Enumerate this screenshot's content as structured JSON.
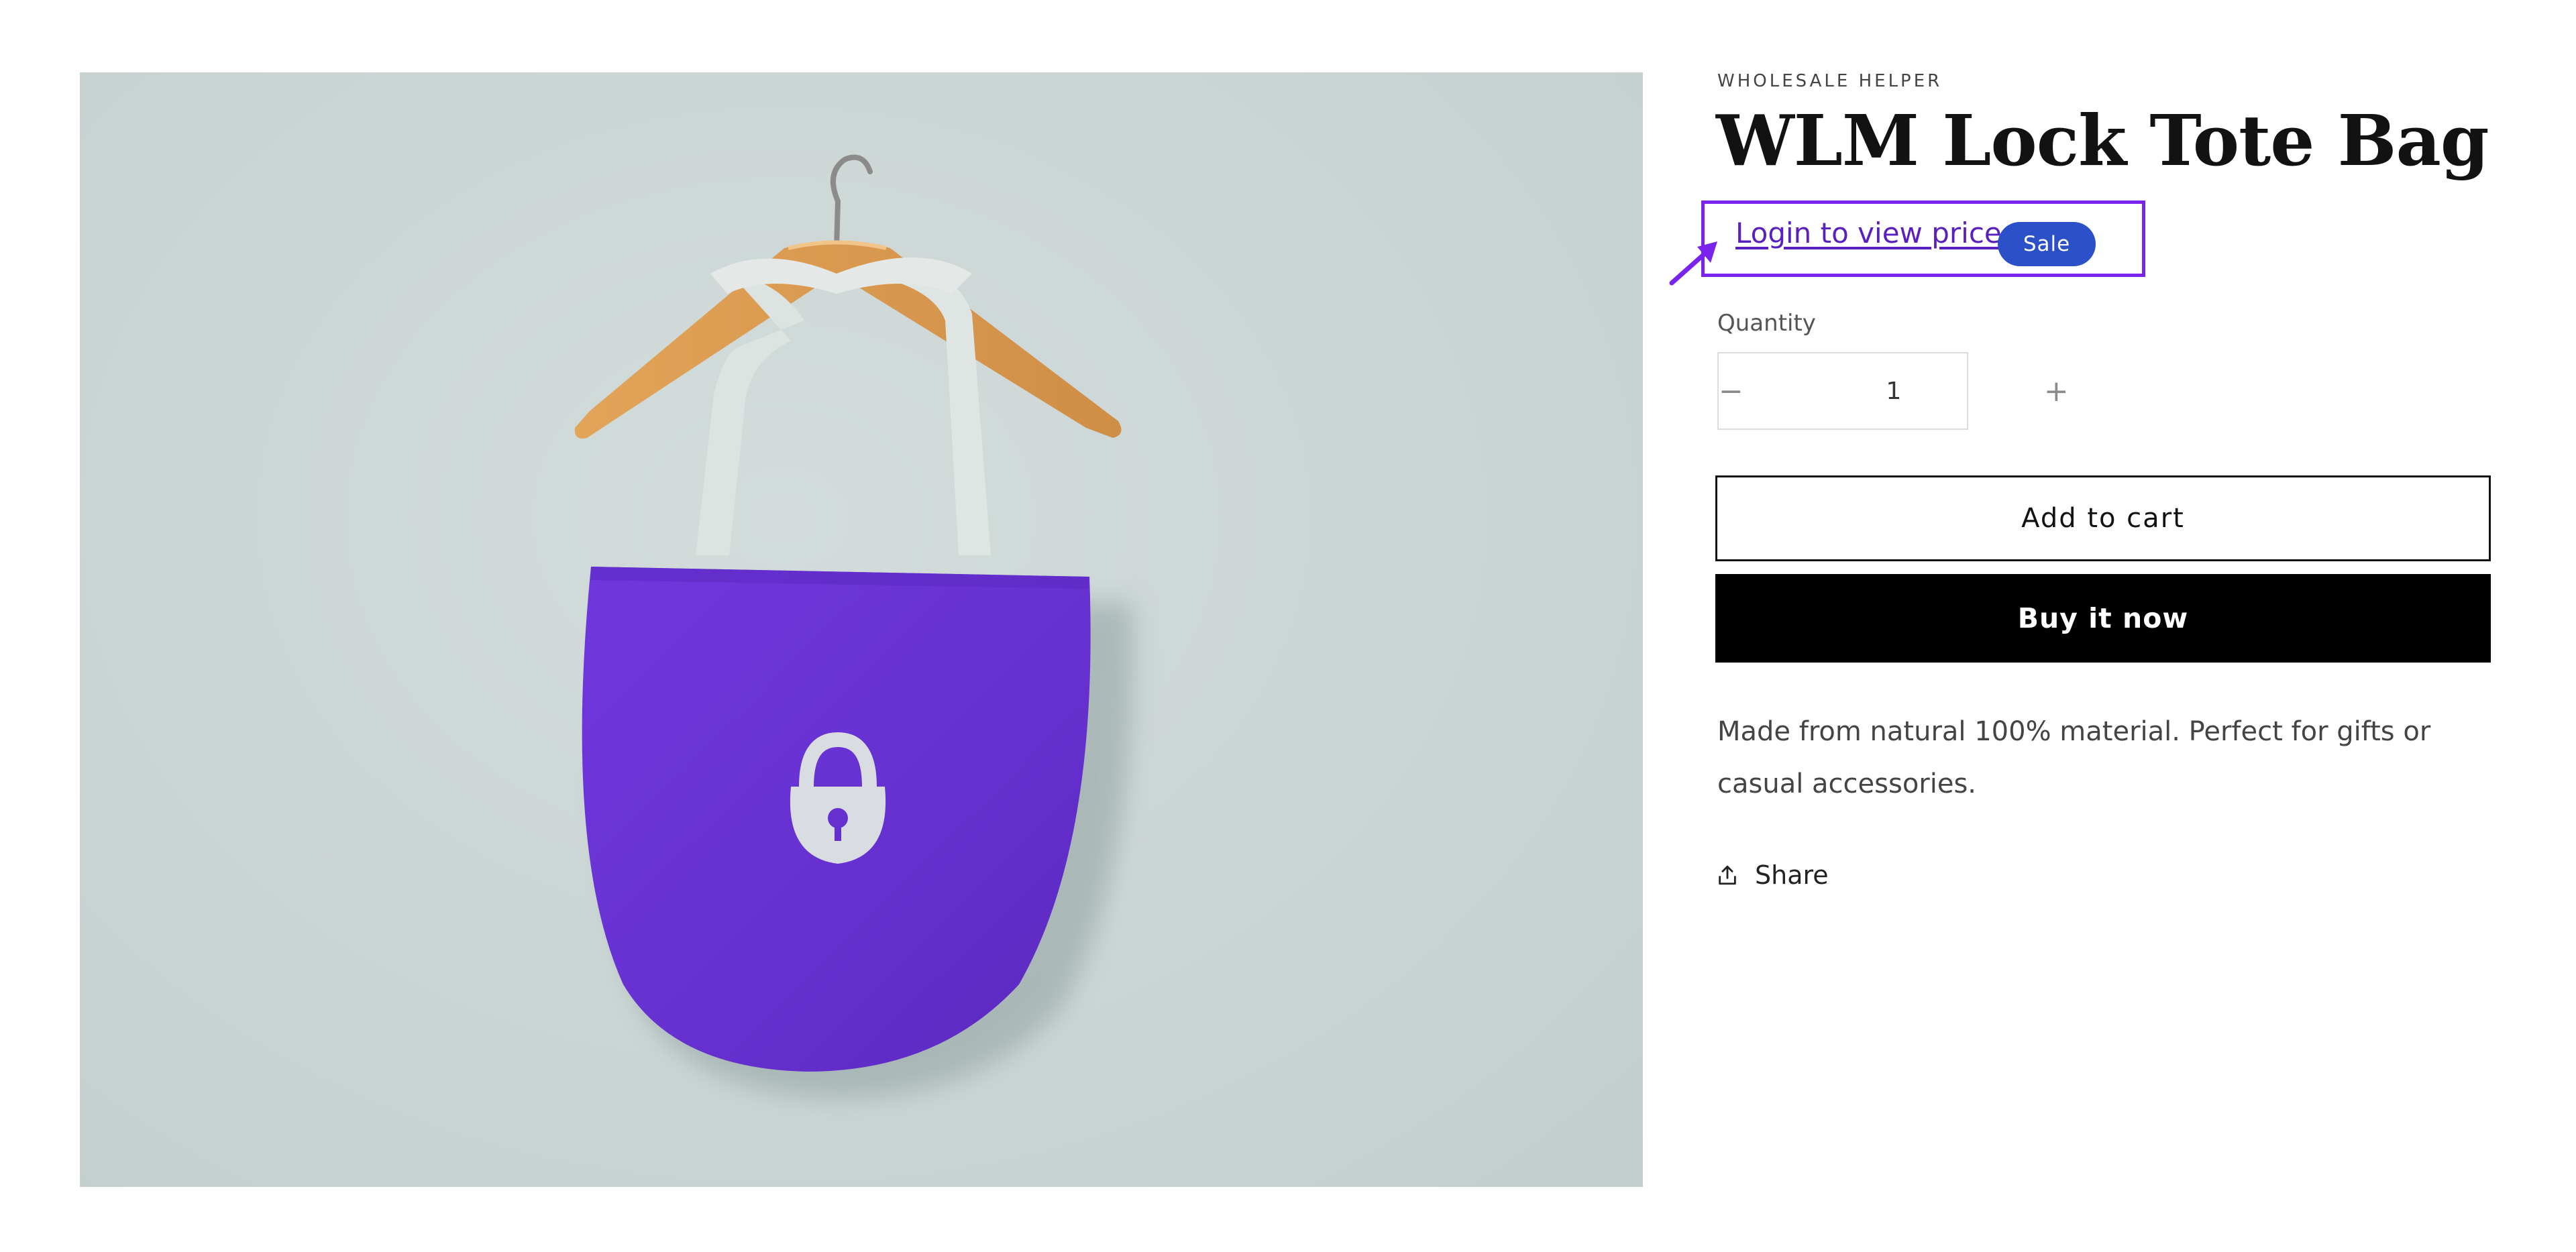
{
  "product": {
    "vendor": "WHOLESALE HELPER",
    "title": "WLM Lock Tote Bag",
    "price_link": "Login to view price",
    "badge": "Sale",
    "quantity_label": "Quantity",
    "quantity_value": "1",
    "decrease_symbol": "−",
    "increase_symbol": "+",
    "add_to_cart": "Add to cart",
    "buy_now": "Buy it now",
    "description": "Made from natural 100% material. Perfect for gifts or casual accessories.",
    "share": "Share"
  },
  "colors": {
    "highlight": "#7a23ec",
    "badge": "#2b50c8",
    "bag": "#6a2fd3",
    "link": "#5a1fbf"
  },
  "icons": {
    "share": "share-icon",
    "annotation": "arrow-pointer-icon"
  }
}
